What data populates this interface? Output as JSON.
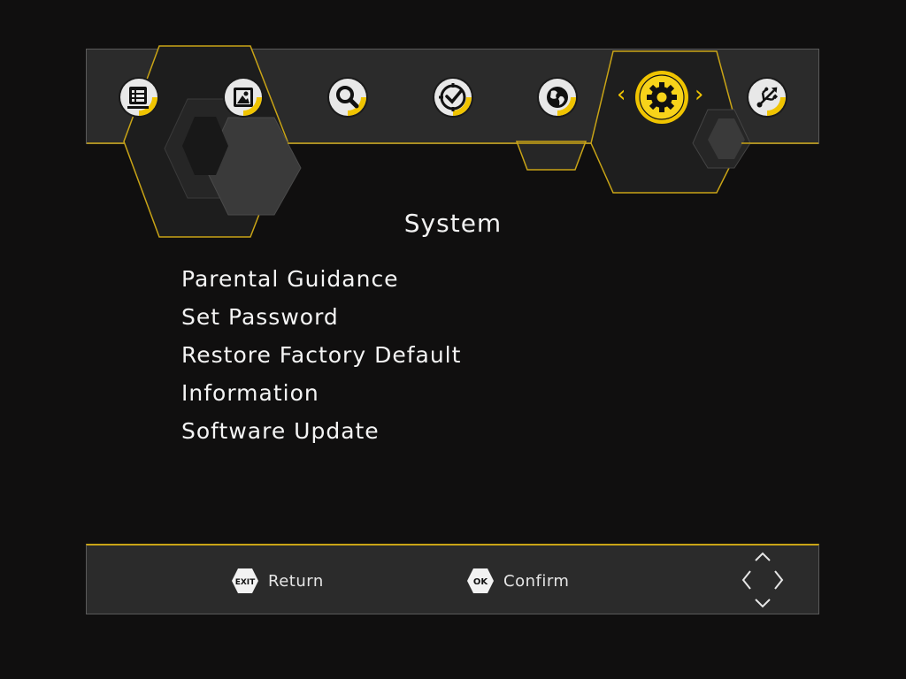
{
  "header": {
    "title": "System"
  },
  "nav": {
    "items": [
      {
        "icon": "program-list-icon"
      },
      {
        "icon": "picture-icon"
      },
      {
        "icon": "search-icon"
      },
      {
        "icon": "clock-icon"
      },
      {
        "icon": "globe-icon"
      },
      {
        "icon": "gear-icon",
        "active": true
      },
      {
        "icon": "usb-icon"
      }
    ],
    "prev_arrow": "‹",
    "next_arrow": "›"
  },
  "menu": {
    "items": [
      "Parental Guidance",
      "Set Password",
      "Restore Factory Default",
      "Information",
      "Software Update"
    ]
  },
  "footer": {
    "exit_badge": "EXIT",
    "exit_label": "Return",
    "ok_badge": "OK",
    "ok_label": "Confirm"
  },
  "colors": {
    "accent": "#f0c400",
    "background": "#100f0f",
    "panel": "#2b2b2b",
    "text": "#f2f2f2"
  }
}
